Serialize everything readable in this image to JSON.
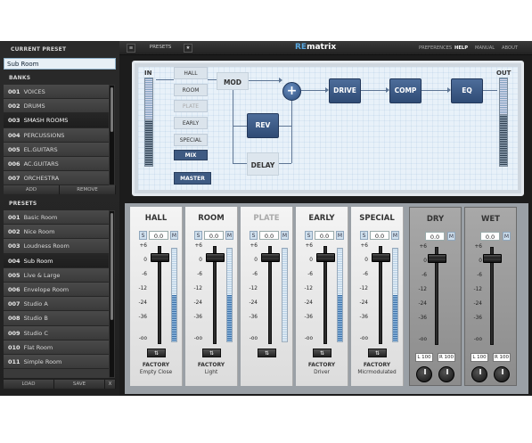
{
  "sidebar": {
    "current_preset_title": "CURRENT PRESET",
    "current_preset_value": "Sub Room",
    "banks_title": "BANKS",
    "banks": [
      {
        "num": "001",
        "name": "VOICES"
      },
      {
        "num": "002",
        "name": "DRUMS"
      },
      {
        "num": "003",
        "name": "SMASH ROOMS"
      },
      {
        "num": "004",
        "name": "PERCUSSIONS"
      },
      {
        "num": "005",
        "name": "EL.GUITARS"
      },
      {
        "num": "006",
        "name": "AC.GUITARS"
      },
      {
        "num": "007",
        "name": "ORCHESTRA"
      }
    ],
    "banks_selected": "003",
    "add_label": "ADD",
    "remove_label": "REMOVE",
    "presets_title": "PRESETS",
    "presets": [
      {
        "num": "001",
        "name": "Basic Room"
      },
      {
        "num": "002",
        "name": "Nice Room"
      },
      {
        "num": "003",
        "name": "Loudness Room"
      },
      {
        "num": "004",
        "name": "Sub Room"
      },
      {
        "num": "005",
        "name": "Live & Large"
      },
      {
        "num": "006",
        "name": "Envelope Room"
      },
      {
        "num": "007",
        "name": "Studio A"
      },
      {
        "num": "008",
        "name": "Studio B"
      },
      {
        "num": "009",
        "name": "Studio C"
      },
      {
        "num": "010",
        "name": "Flat Room"
      },
      {
        "num": "011",
        "name": "Simple Room"
      }
    ],
    "presets_selected": "004",
    "load_label": "LOAD",
    "save_label": "SAVE",
    "close_label": "X"
  },
  "topbar": {
    "menu_icon": "menu-icon",
    "presets_label": "PRESETS",
    "star_icon": "star-icon",
    "logo_prefix": "RE",
    "logo_name": "matrix",
    "links": [
      "PREFERENCES",
      "HELP",
      "MANUAL",
      "ABOUT"
    ],
    "active_link": "HELP"
  },
  "routing": {
    "in_label": "IN",
    "out_label": "OUT",
    "modules": [
      "HALL",
      "ROOM",
      "PLATE",
      "EARLY",
      "SPECIAL",
      "MIX"
    ],
    "disabled_modules": [
      "PLATE"
    ],
    "mix_label": "MIX",
    "master_label": "MASTER",
    "mod_label": "MOD",
    "rev_label": "REV",
    "delay_label": "DELAY",
    "drive_label": "DRIVE",
    "comp_label": "COMP",
    "eq_label": "EQ",
    "plus_symbol": "+"
  },
  "mixer": {
    "scale": [
      "+6",
      "0",
      "-6",
      "-12",
      "-24",
      "-36",
      "-oo"
    ],
    "channels": [
      {
        "name": "HALL",
        "value": "0.0",
        "solo": "S",
        "mute": "M",
        "mode_icon": "swap-icon",
        "footer": "FACTORY",
        "preset": "Empty Close",
        "level": 0.5
      },
      {
        "name": "ROOM",
        "value": "0.0",
        "solo": "S",
        "mute": "M",
        "mode_icon": "swap-icon",
        "footer": "FACTORY",
        "preset": "Light",
        "level": 0.5
      },
      {
        "name": "PLATE",
        "value": "0.0",
        "solo": "S",
        "mute": "M",
        "mode_icon": "swap-icon",
        "footer": "",
        "preset": "",
        "level": 0.0
      },
      {
        "name": "EARLY",
        "value": "0.0",
        "solo": "S",
        "mute": "M",
        "mode_icon": "swap-icon",
        "footer": "FACTORY",
        "preset": "Driver",
        "level": 0.5
      },
      {
        "name": "SPECIAL",
        "value": "0.0",
        "solo": "S",
        "mute": "M",
        "mode_icon": "swap-icon",
        "footer": "FACTORY",
        "preset": "Micrmodulated",
        "level": 0.5
      }
    ],
    "dry": {
      "name": "DRY",
      "value": "0.0",
      "mute": "M",
      "l_label": "L 100",
      "r_label": "R 100"
    },
    "wet": {
      "name": "WET",
      "value": "0.0",
      "mute": "M",
      "l_label": "L 100",
      "r_label": "R 100"
    },
    "mode_glyph": "⇅"
  }
}
